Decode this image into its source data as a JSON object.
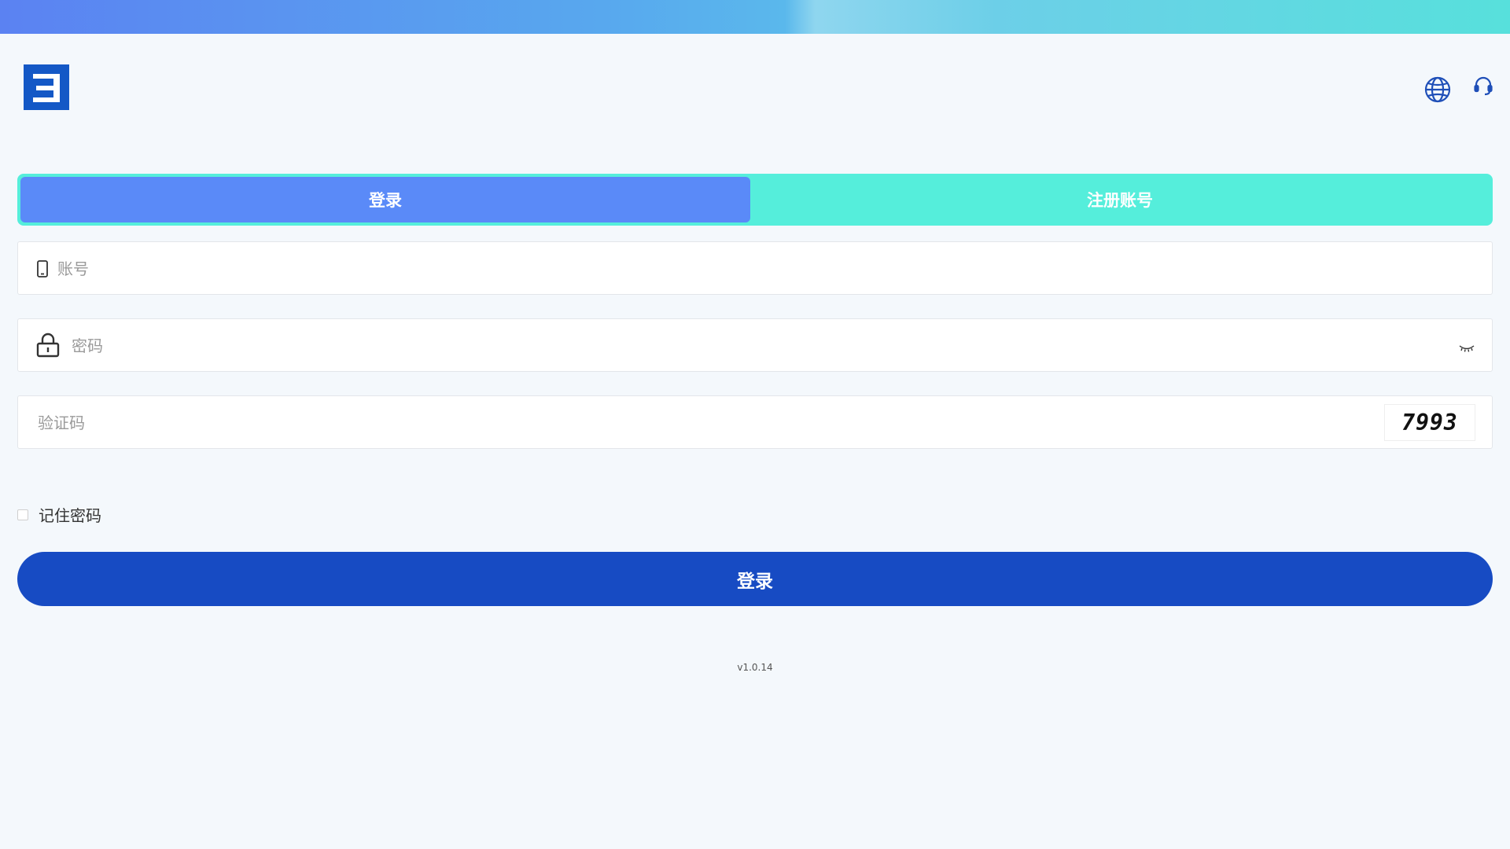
{
  "tabs": {
    "login_label": "登录",
    "register_label": "注册账号"
  },
  "form": {
    "account_placeholder": "账号",
    "password_placeholder": "密码",
    "captcha_placeholder": "验证码",
    "captcha_code": "7993",
    "remember_label": "记住密码",
    "remember_checked": false
  },
  "login_button_label": "登录",
  "version": "v1.0.14",
  "icons": {
    "logo": "brand-logo",
    "language": "globe-icon",
    "support": "headset-icon",
    "account": "phone-icon",
    "password": "lock-icon",
    "visibility": "eye-closed-icon"
  },
  "colors": {
    "primary": "#174bc3",
    "tab_active": "#5a8af8",
    "tab_bar": "#55eedb"
  }
}
